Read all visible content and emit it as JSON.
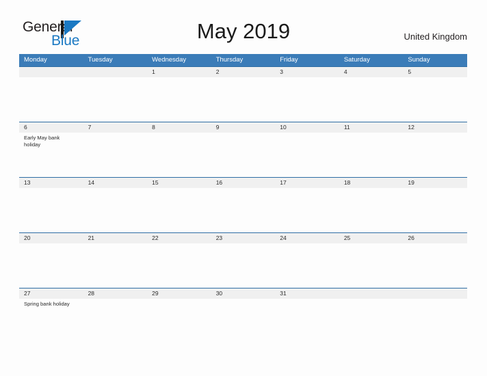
{
  "brand": {
    "word_one": "General",
    "word_two": "Blue",
    "mark_icon": "flag-triangle-icon",
    "accent_color": "#1b79c3"
  },
  "header": {
    "title": "May 2019",
    "country": "United Kingdom"
  },
  "theme": {
    "header_bar_color": "#3b7cb8",
    "week_band_color": "#f0f0f0",
    "week_rule_color": "#2e6da4",
    "page_background": "#fdfdfd",
    "text_color": "#2a2a2a"
  },
  "calendar": {
    "weekday_headers": [
      "Monday",
      "Tuesday",
      "Wednesday",
      "Thursday",
      "Friday",
      "Saturday",
      "Sunday"
    ],
    "weeks": [
      [
        {
          "day": "",
          "event": ""
        },
        {
          "day": "",
          "event": ""
        },
        {
          "day": "1",
          "event": ""
        },
        {
          "day": "2",
          "event": ""
        },
        {
          "day": "3",
          "event": ""
        },
        {
          "day": "4",
          "event": ""
        },
        {
          "day": "5",
          "event": ""
        }
      ],
      [
        {
          "day": "6",
          "event": "Early May bank holiday"
        },
        {
          "day": "7",
          "event": ""
        },
        {
          "day": "8",
          "event": ""
        },
        {
          "day": "9",
          "event": ""
        },
        {
          "day": "10",
          "event": ""
        },
        {
          "day": "11",
          "event": ""
        },
        {
          "day": "12",
          "event": ""
        }
      ],
      [
        {
          "day": "13",
          "event": ""
        },
        {
          "day": "14",
          "event": ""
        },
        {
          "day": "15",
          "event": ""
        },
        {
          "day": "16",
          "event": ""
        },
        {
          "day": "17",
          "event": ""
        },
        {
          "day": "18",
          "event": ""
        },
        {
          "day": "19",
          "event": ""
        }
      ],
      [
        {
          "day": "20",
          "event": ""
        },
        {
          "day": "21",
          "event": ""
        },
        {
          "day": "22",
          "event": ""
        },
        {
          "day": "23",
          "event": ""
        },
        {
          "day": "24",
          "event": ""
        },
        {
          "day": "25",
          "event": ""
        },
        {
          "day": "26",
          "event": ""
        }
      ],
      [
        {
          "day": "27",
          "event": "Spring bank holiday"
        },
        {
          "day": "28",
          "event": ""
        },
        {
          "day": "29",
          "event": ""
        },
        {
          "day": "30",
          "event": ""
        },
        {
          "day": "31",
          "event": ""
        },
        {
          "day": "",
          "event": ""
        },
        {
          "day": "",
          "event": ""
        }
      ]
    ]
  }
}
